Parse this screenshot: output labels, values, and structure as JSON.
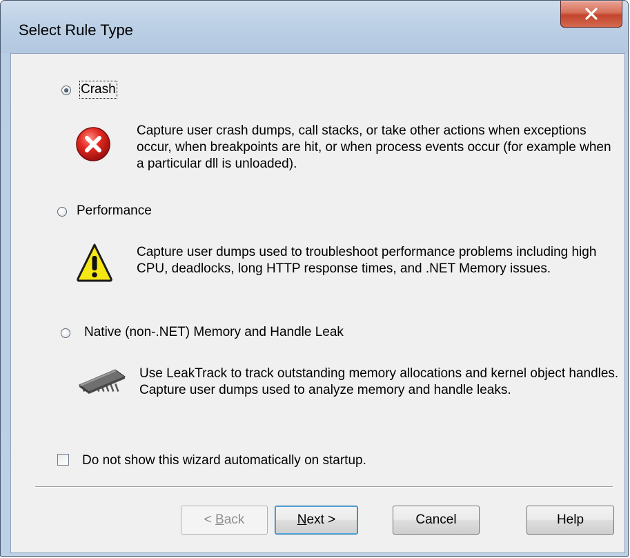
{
  "window": {
    "title": "Select Rule Type"
  },
  "options": [
    {
      "label": "Crash",
      "checked": true,
      "icon": "error-icon",
      "description": "Capture user crash dumps, call stacks, or take other actions when exceptions occur, when breakpoints are hit, or when process events occur (for example when a particular dll is unloaded)."
    },
    {
      "label": "Performance",
      "checked": false,
      "icon": "warning-icon",
      "description": "Capture user dumps used to troubleshoot performance problems including high CPU, deadlocks, long HTTP response times, and .NET Memory issues."
    },
    {
      "label": "Native (non-.NET) Memory and Handle Leak",
      "checked": false,
      "icon": "memory-chip-icon",
      "description": "Use LeakTrack to track outstanding memory allocations and kernel object handles. Capture user dumps used to analyze memory and handle leaks."
    }
  ],
  "startup_checkbox": {
    "label": "Do not show this wizard automatically on startup.",
    "checked": false
  },
  "buttons": {
    "back": {
      "prefix": "< ",
      "mnemonic": "B",
      "rest": "ack",
      "enabled": false
    },
    "next": {
      "mnemonic": "N",
      "rest": "ext >",
      "enabled": true
    },
    "cancel": {
      "label": "Cancel"
    },
    "help": {
      "label": "Help"
    }
  },
  "colors": {
    "error": "#d81e1e",
    "warning": "#f5e616",
    "close_button": "#c3452c"
  }
}
